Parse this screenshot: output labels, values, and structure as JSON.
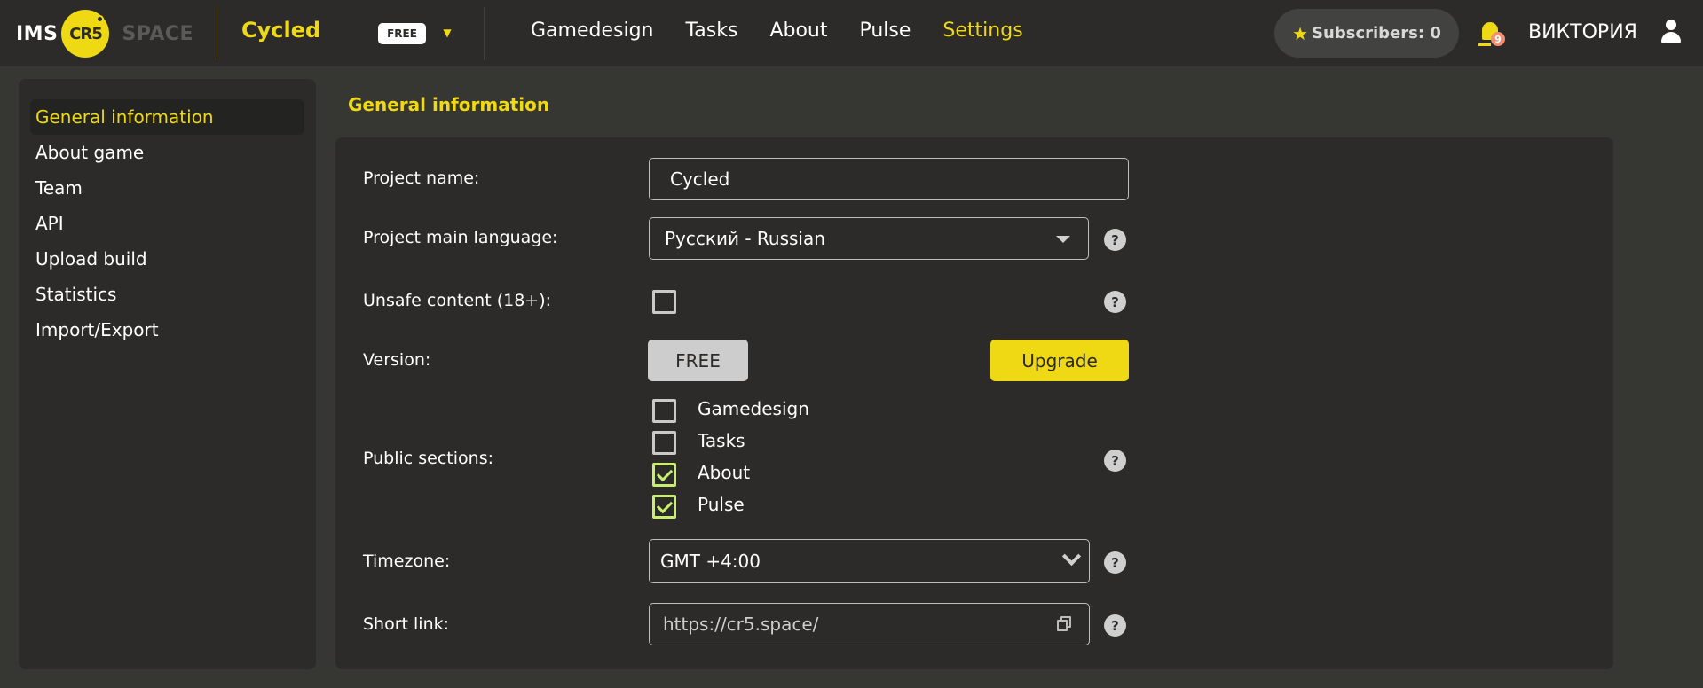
{
  "header": {
    "logo": {
      "left": "IMS",
      "circle": "CR5",
      "right": "SPACE"
    },
    "project_name": "Cycled",
    "plan_badge": "FREE",
    "nav": [
      {
        "label": "Gamedesign",
        "active": false
      },
      {
        "label": "Tasks",
        "active": false
      },
      {
        "label": "About",
        "active": false
      },
      {
        "label": "Pulse",
        "active": false
      },
      {
        "label": "Settings",
        "active": true
      }
    ],
    "subscribers_label": "Subscribers: 0",
    "notifications_count": "9",
    "username": "ВИКТОРИЯ"
  },
  "sidebar": {
    "items": [
      {
        "label": "General information",
        "active": true
      },
      {
        "label": "About game",
        "active": false
      },
      {
        "label": "Team",
        "active": false
      },
      {
        "label": "API",
        "active": false
      },
      {
        "label": "Upload build",
        "active": false
      },
      {
        "label": "Statistics",
        "active": false
      },
      {
        "label": "Import/Export",
        "active": false
      }
    ]
  },
  "main": {
    "title": "General information",
    "project_name": {
      "label": "Project name:",
      "value": "Cycled"
    },
    "language": {
      "label": "Project main language:",
      "value": "Русский - Russian"
    },
    "unsafe": {
      "label": "Unsafe content (18+):",
      "checked": false
    },
    "version": {
      "label": "Version:",
      "current": "FREE",
      "upgrade_label": "Upgrade"
    },
    "public_sections": {
      "label": "Public sections:",
      "options": [
        {
          "label": "Gamedesign",
          "checked": false
        },
        {
          "label": "Tasks",
          "checked": false
        },
        {
          "label": "About",
          "checked": true
        },
        {
          "label": "Pulse",
          "checked": true
        }
      ]
    },
    "timezone": {
      "label": "Timezone:",
      "value": "GMT +4:00"
    },
    "short_link": {
      "label": "Short link:",
      "value": "https://cr5.space/"
    },
    "help_glyph": "?"
  },
  "colors": {
    "accent": "#eed914",
    "header_bg": "#2c2b29",
    "page_bg": "#363632",
    "checked": "#c8ee6e",
    "badge": "#f08f73"
  }
}
